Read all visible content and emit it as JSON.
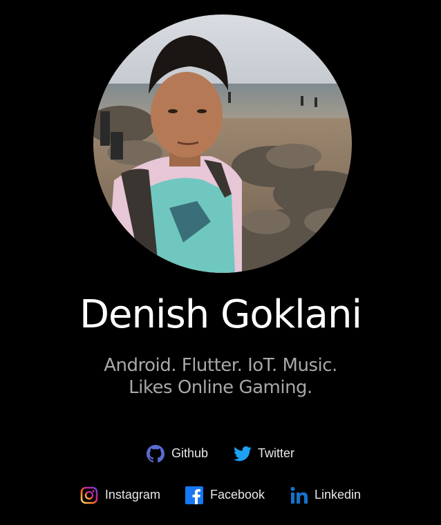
{
  "profile": {
    "name": "Denish Goklani",
    "tagline_line1": "Android. Flutter. IoT. Music.",
    "tagline_line2": "Likes Online Gaming.",
    "avatar_icon": "profile-photo"
  },
  "links": {
    "github": {
      "label": "Github",
      "icon": "github-icon",
      "color": "#5b6bd1"
    },
    "twitter": {
      "label": "Twitter",
      "icon": "twitter-icon",
      "color": "#1da1f2"
    },
    "instagram": {
      "label": "Instagram",
      "icon": "instagram-icon",
      "color": "#e1306c"
    },
    "facebook": {
      "label": "Facebook",
      "icon": "facebook-icon",
      "color": "#1877f2"
    },
    "linkedin": {
      "label": "Linkedin",
      "icon": "linkedin-icon",
      "color": "#1572c8"
    }
  },
  "colors": {
    "background": "#000000",
    "name_text": "#ffffff",
    "tagline_text": "#a8a8a8"
  }
}
